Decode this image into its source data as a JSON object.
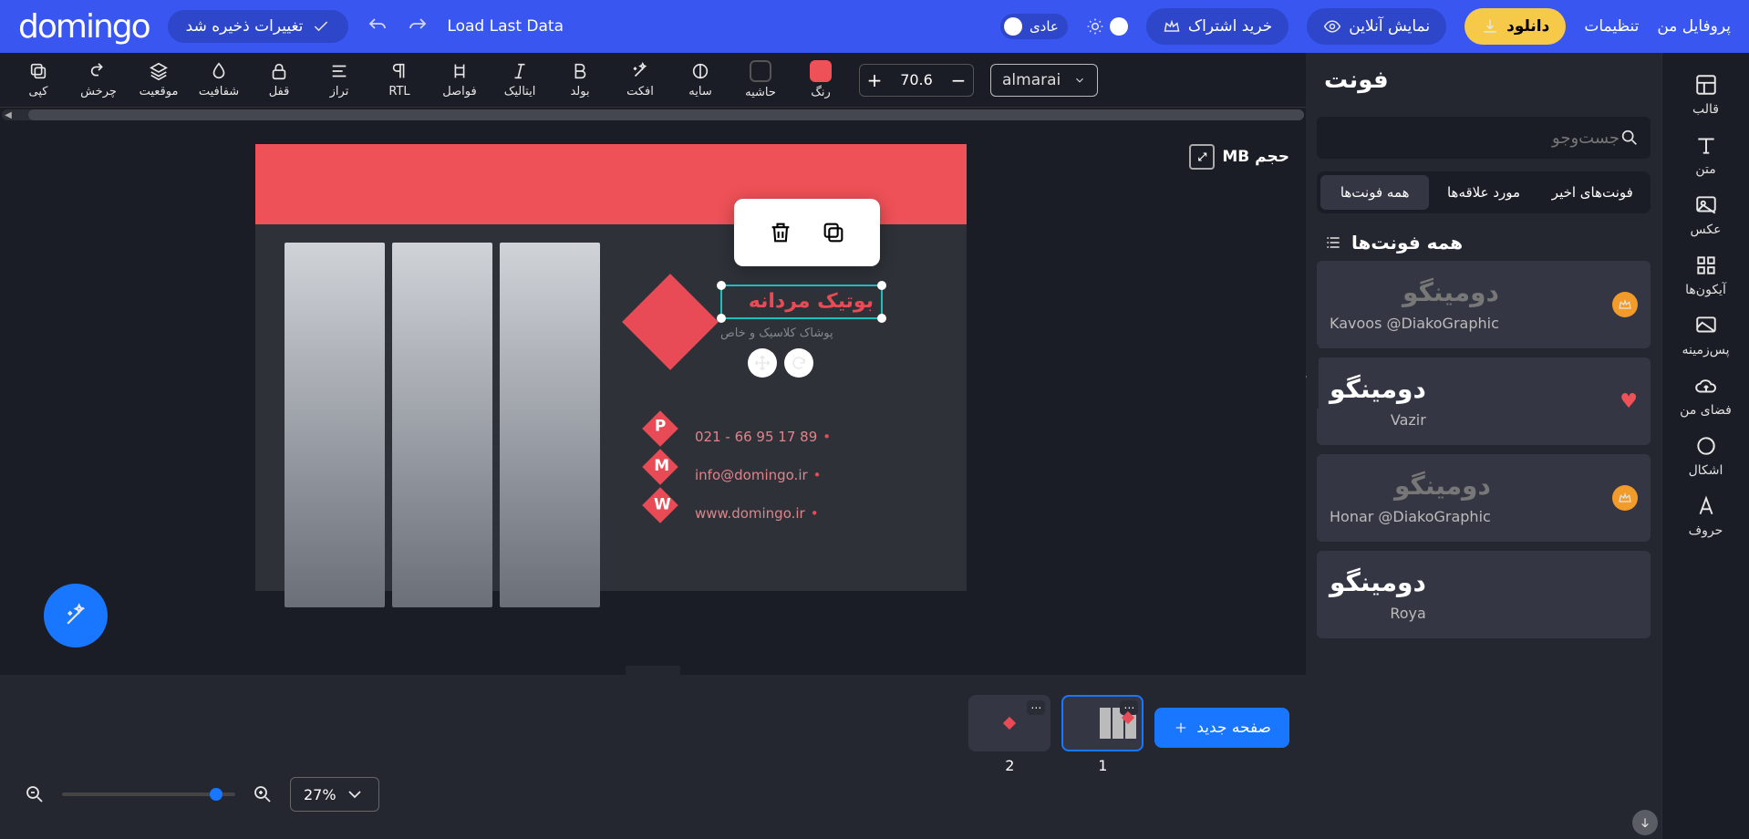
{
  "topbar": {
    "logo": "domingo",
    "saved": "تغییرات ذخیره شد",
    "load_last": "Load Last Data",
    "mode": "عادی",
    "subscribe": "خرید اشتراک",
    "preview": "نمایش آنلاین",
    "download": "دانلود",
    "settings": "تنظیمات",
    "profile": "پروفایل من"
  },
  "ribbon": {
    "copy": "کپی",
    "rotate": "چرخش",
    "position": "موقعیت",
    "opacity": "شفافیت",
    "lock": "قفل",
    "align": "تراز",
    "rtl": "RTL",
    "spacing": "فواصل",
    "italic": "ایتالیک",
    "bold": "بولد",
    "effect": "افکت",
    "shadow": "سایه",
    "margin": "حاشیه",
    "color": "رنگ",
    "font_size": "70.6",
    "font_name": "almarai"
  },
  "rightbar": {
    "template": "قالب",
    "text": "متن",
    "image": "عکس",
    "icons": "آیکون‌ها",
    "background": "پس‌زمینه",
    "myspace": "فضای من",
    "shapes": "اشکال",
    "letters": "حروف"
  },
  "fontpanel": {
    "title": "فونت",
    "search_placeholder": "جست‌وجو",
    "tabs": {
      "all": "همه فونت‌ها",
      "fav": "مورد علاقه‌ها",
      "recent": "فونت‌های اخیر"
    },
    "heading": "همه فونت‌ها",
    "fonts": [
      {
        "preview": "دومینگو",
        "name": "Kavoos @DiakoGraphic",
        "badge": "crown"
      },
      {
        "preview": "دومینگو",
        "name": "Vazir",
        "badge": "heart"
      },
      {
        "preview": "دومینگو",
        "name": "Honar @DiakoGraphic",
        "badge": "crown"
      },
      {
        "preview": "دومینگو",
        "name": "Roya",
        "badge": "none"
      }
    ]
  },
  "canvas": {
    "size_label": "حجم MB",
    "title": "بوتیک مردانه",
    "subtitle": "پوشاک کلاسیک و خاص",
    "phone": "021 - 66 95 17 89",
    "phone_letter": "P",
    "email": "info@domingo.ir",
    "email_letter": "M",
    "web": "www.domingo.ir",
    "web_letter": "W"
  },
  "bottom": {
    "new_page": "صفحه جدید",
    "zoom": "27%",
    "page1": "1",
    "page2": "2"
  }
}
